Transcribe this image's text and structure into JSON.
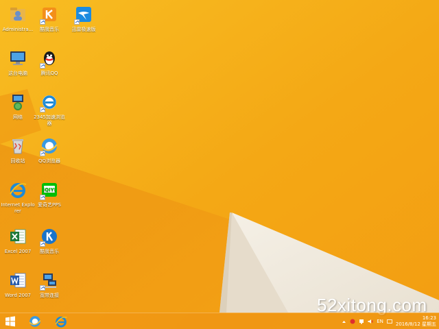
{
  "desktop": {
    "icons": [
      {
        "label": "Administra...",
        "icon": "user-folder-icon"
      },
      {
        "label": "酷我音乐",
        "icon": "kuwo-music-icon"
      },
      {
        "label": "迅雷极速版",
        "icon": "xunlei-icon"
      },
      {
        "label": "这台电脑",
        "icon": "computer-icon"
      },
      {
        "label": "腾讯QQ",
        "icon": "qq-icon"
      },
      {
        "label": "网络",
        "icon": "network-icon"
      },
      {
        "label": "2345加速浏览器",
        "icon": "browser-2345-icon"
      },
      {
        "label": "回收站",
        "icon": "recycle-bin-icon"
      },
      {
        "label": "QQ浏览器",
        "icon": "qq-browser-icon"
      },
      {
        "label": "Internet Explorer",
        "icon": "ie-icon"
      },
      {
        "label": "爱奇艺PPS",
        "icon": "iqiyi-icon"
      },
      {
        "label": "Excel 2007",
        "icon": "excel-icon"
      },
      {
        "label": "酷我音乐",
        "icon": "kuwo-k-icon"
      },
      {
        "label": "Word 2007",
        "icon": "word-icon"
      },
      {
        "label": "宽带连接",
        "icon": "broadband-icon"
      }
    ]
  },
  "watermark": "52xitong.com",
  "taskbar": {
    "items": [
      {
        "icon": "start-icon"
      },
      {
        "icon": "qq-browser-icon"
      },
      {
        "icon": "ie-icon"
      }
    ],
    "tray": {
      "language": "EN",
      "time": "16:23",
      "date": "2016/8/12 星期五"
    }
  },
  "colors": {
    "wallpaper": "#f3a414",
    "wallpaper_light": "#f6b81c",
    "triangle": "#f3ece0",
    "triangle_shadow": "#d8cfc0",
    "taskbar": "#f0961e"
  }
}
